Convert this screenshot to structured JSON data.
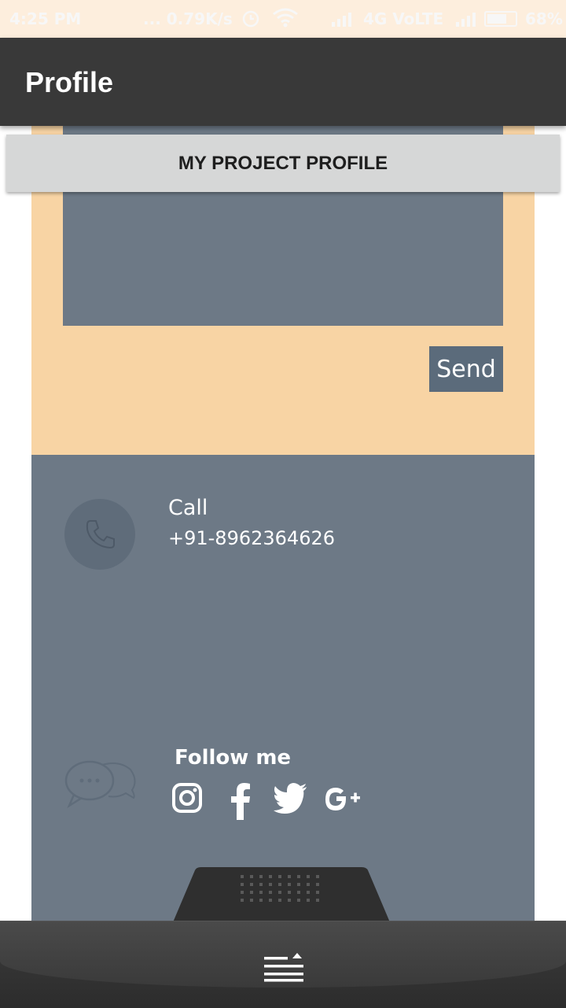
{
  "status_bar": {
    "time": "4:25 PM",
    "network_speed": "... 0.79K/s",
    "signal_text": "4G VoLTE",
    "battery": "68%",
    "battery_level": 0.68
  },
  "app_bar": {
    "title": "Profile"
  },
  "tab": {
    "label": "MY PROJECT PROFILE"
  },
  "form": {
    "send_label": "Send"
  },
  "contact": {
    "call_label": "Call",
    "phone_number": "+91-8962364626",
    "follow_label": "Follow me",
    "social_icons": [
      "instagram-icon",
      "facebook-icon",
      "twitter-icon",
      "google-plus-icon"
    ]
  },
  "colors": {
    "app_bar": "#393939",
    "form_bg": "#f8d4a4",
    "panel_bg": "#6d7986",
    "send_button": "#5b6b7b",
    "tab_bg": "#d6d7d7"
  }
}
